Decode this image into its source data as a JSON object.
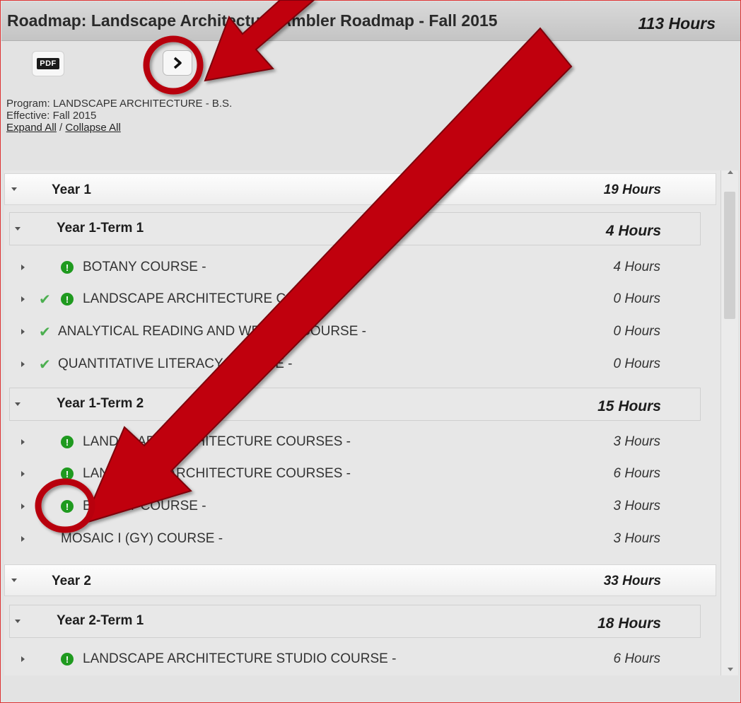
{
  "header": {
    "title": "Roadmap: Landscape Architecture Ambler Roadmap - Fall 2015",
    "total_hours": "113 Hours"
  },
  "toolbar": {
    "pdf_label": "PDF",
    "next_icon": "chevron-right-icon"
  },
  "program": {
    "program_line": "Program: LANDSCAPE ARCHITECTURE - B.S.",
    "effective_line": "Effective: Fall 2015",
    "expand_all": "Expand All",
    "separator": " / ",
    "collapse_all": "Collapse All"
  },
  "years": [
    {
      "label": "Year 1",
      "hours": "19 Hours",
      "terms": [
        {
          "label": "Year 1-Term 1",
          "hours": "4 Hours",
          "courses": [
            {
              "label": "BOTANY COURSE -",
              "hours": "4 Hours",
              "check": false,
              "alert": true
            },
            {
              "label": "LANDSCAPE ARCHITECTURE COURSE -",
              "hours": "0 Hours",
              "check": true,
              "alert": true
            },
            {
              "label": "ANALYTICAL READING AND WRITING COURSE -",
              "hours": "0 Hours",
              "check": true,
              "alert": false
            },
            {
              "label": "QUANTITATIVE LITERACY COURSE -",
              "hours": "0 Hours",
              "check": true,
              "alert": false
            }
          ]
        },
        {
          "label": "Year 1-Term 2",
          "hours": "15 Hours",
          "courses": [
            {
              "label": "LANDSCAPE ARCHITECTURE COURSES -",
              "hours": "3 Hours",
              "check": false,
              "alert": true
            },
            {
              "label": "LANDSCAPE ARCHITECTURE COURSES -",
              "hours": "6 Hours",
              "check": false,
              "alert": true
            },
            {
              "label": "BOTANY COURSE -",
              "hours": "3 Hours",
              "check": false,
              "alert": true
            },
            {
              "label": "MOSAIC I (GY) COURSE -",
              "hours": "3 Hours",
              "check": false,
              "alert": false
            }
          ]
        }
      ]
    },
    {
      "label": "Year 2",
      "hours": "33 Hours",
      "terms": [
        {
          "label": "Year 2-Term 1",
          "hours": "18 Hours",
          "courses": [
            {
              "label": "LANDSCAPE ARCHITECTURE STUDIO COURSE -",
              "hours": "6 Hours",
              "check": false,
              "alert": true
            }
          ]
        }
      ]
    }
  ],
  "colors": {
    "accent_red": "#c0000a",
    "alert_green": "#1f9a1f",
    "check_green": "#4caf50"
  }
}
